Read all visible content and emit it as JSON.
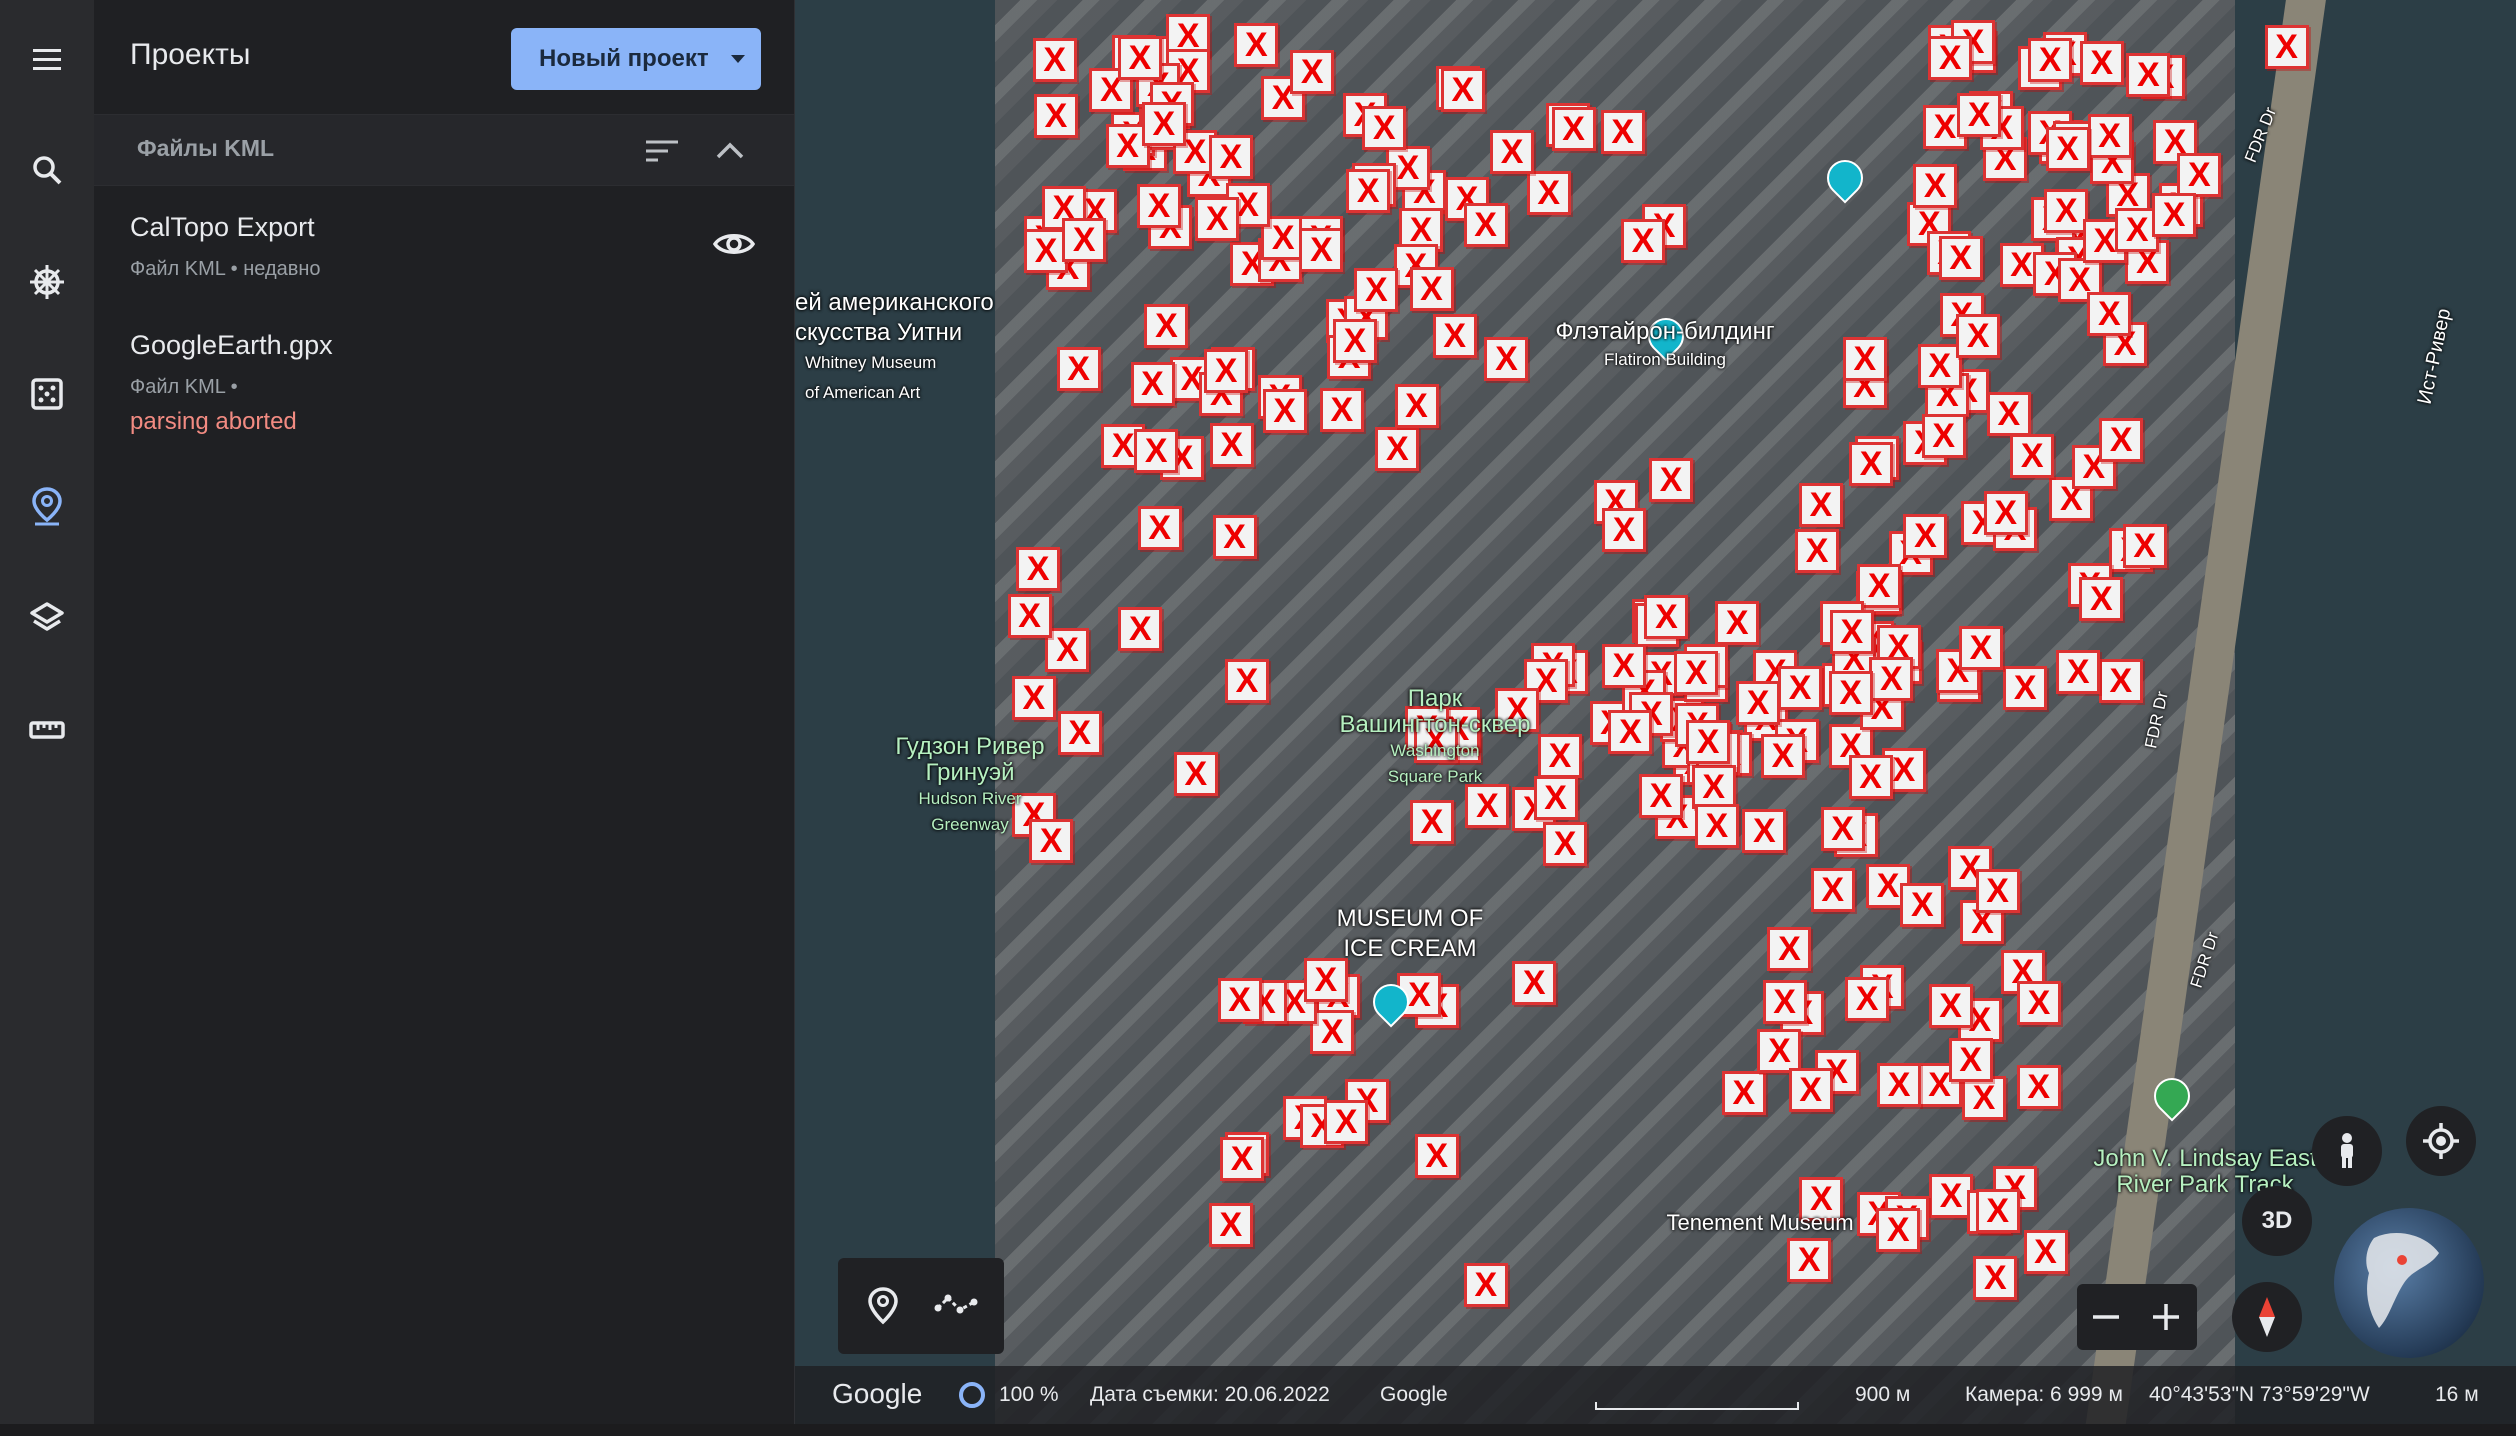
{
  "sidebar": {
    "icons": [
      "menu-icon",
      "search-icon",
      "voyager-wheel-icon",
      "dice-icon",
      "projects-pin-icon",
      "layers-icon",
      "ruler-icon"
    ]
  },
  "panel": {
    "title": "Проекты",
    "new_project_label": "Новый проект",
    "section_title": "Файлы KML",
    "items": [
      {
        "name": "CalTopo Export",
        "sub": "Файл KML • недавно",
        "error": ""
      },
      {
        "name": "GoogleEarth.gpx",
        "sub": "Файл KML •",
        "error": "parsing aborted"
      }
    ]
  },
  "map": {
    "marker_text": "X",
    "labels": {
      "whitney_ru_1": "ей американского",
      "whitney_ru_2": "скусства Уитни",
      "whitney_en_1": "Whitney Museum",
      "whitney_en_2": "of American Art",
      "flatiron_ru": "Флэтайрон-билдинг",
      "flatiron_en": "Flatiron Building",
      "park_ru_1": "Парк",
      "park_ru_2": "Вашингтон-сквер",
      "park_en_1": "Washington",
      "park_en_2": "Square Park",
      "hudson_ru_1": "Гудзон Ривер",
      "hudson_ru_2": "Гринуэй",
      "hudson_en_1": "Hudson River",
      "hudson_en_2": "Greenway",
      "icecream_1": "MUSEUM OF",
      "icecream_2": "ICE CREAM",
      "lindsay_1": "John V. Lindsay East",
      "lindsay_2": "River Park Track",
      "east_river": "Ист-Ривер",
      "fdr_1": "FDR Dr",
      "fdr_2": "FDR Dr",
      "fdr_3": "FDR Dr",
      "tenement": "Tenement Museum"
    },
    "btn_3d": "3D"
  },
  "status_bar": {
    "google_logo": "Google",
    "loading_pct": "100 %",
    "capture_date": "Дата съемки: 20.06.2022",
    "attribution": "Google",
    "scale": "900 м",
    "camera": "Камера: 6 999 м",
    "coords": "40°43'53\"N 73°59'29\"W",
    "elevation": "16 м"
  },
  "colors": {
    "accent": "#8ab4f8",
    "error": "#f28b82",
    "marker_border": "#dd3333",
    "marker_text": "#ee0000",
    "water": "#2c3e46"
  }
}
